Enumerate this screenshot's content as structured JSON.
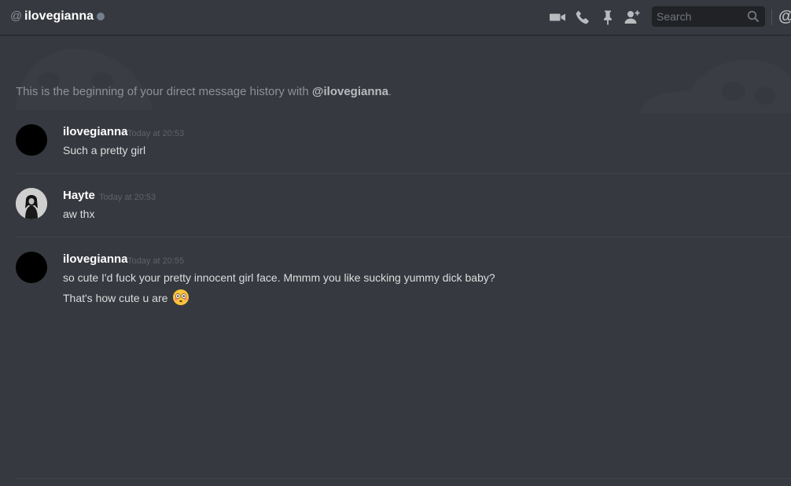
{
  "header": {
    "at_symbol": "@",
    "channel_name": "ilovegianna",
    "status": "offline",
    "icons": [
      "video-call-icon",
      "voice-call-icon",
      "pin-icon",
      "add-friend-icon"
    ],
    "search_placeholder": "Search",
    "mention_symbol": "@"
  },
  "chat": {
    "beginning_prefix": "This is the beginning of your direct message history with ",
    "beginning_user": "@ilovegianna",
    "beginning_suffix": ".",
    "messages": [
      {
        "author": "ilovegianna",
        "timestamp": "Today at 20:53",
        "lines": [
          "Such a pretty girl"
        ]
      },
      {
        "author": "Hayte",
        "timestamp": "Today at 20:53",
        "lines": [
          "aw thx"
        ]
      },
      {
        "author": "ilovegianna",
        "timestamp": "Today at 20:55",
        "lines": [
          "so cute I'd fuck your pretty innocent girl face. Mmmm you like sucking yummy dick baby?",
          "That's how cute u are"
        ],
        "emoji": "flushed-face-emoji"
      }
    ]
  },
  "colors": {
    "background": "#36393f",
    "header_border": "#26282c",
    "search_background": "#202225",
    "username": "#ffffff",
    "text": "#dcddde",
    "muted": "#8e9297",
    "timestamp": "#5f6369",
    "status_offline": "#747f8d"
  }
}
